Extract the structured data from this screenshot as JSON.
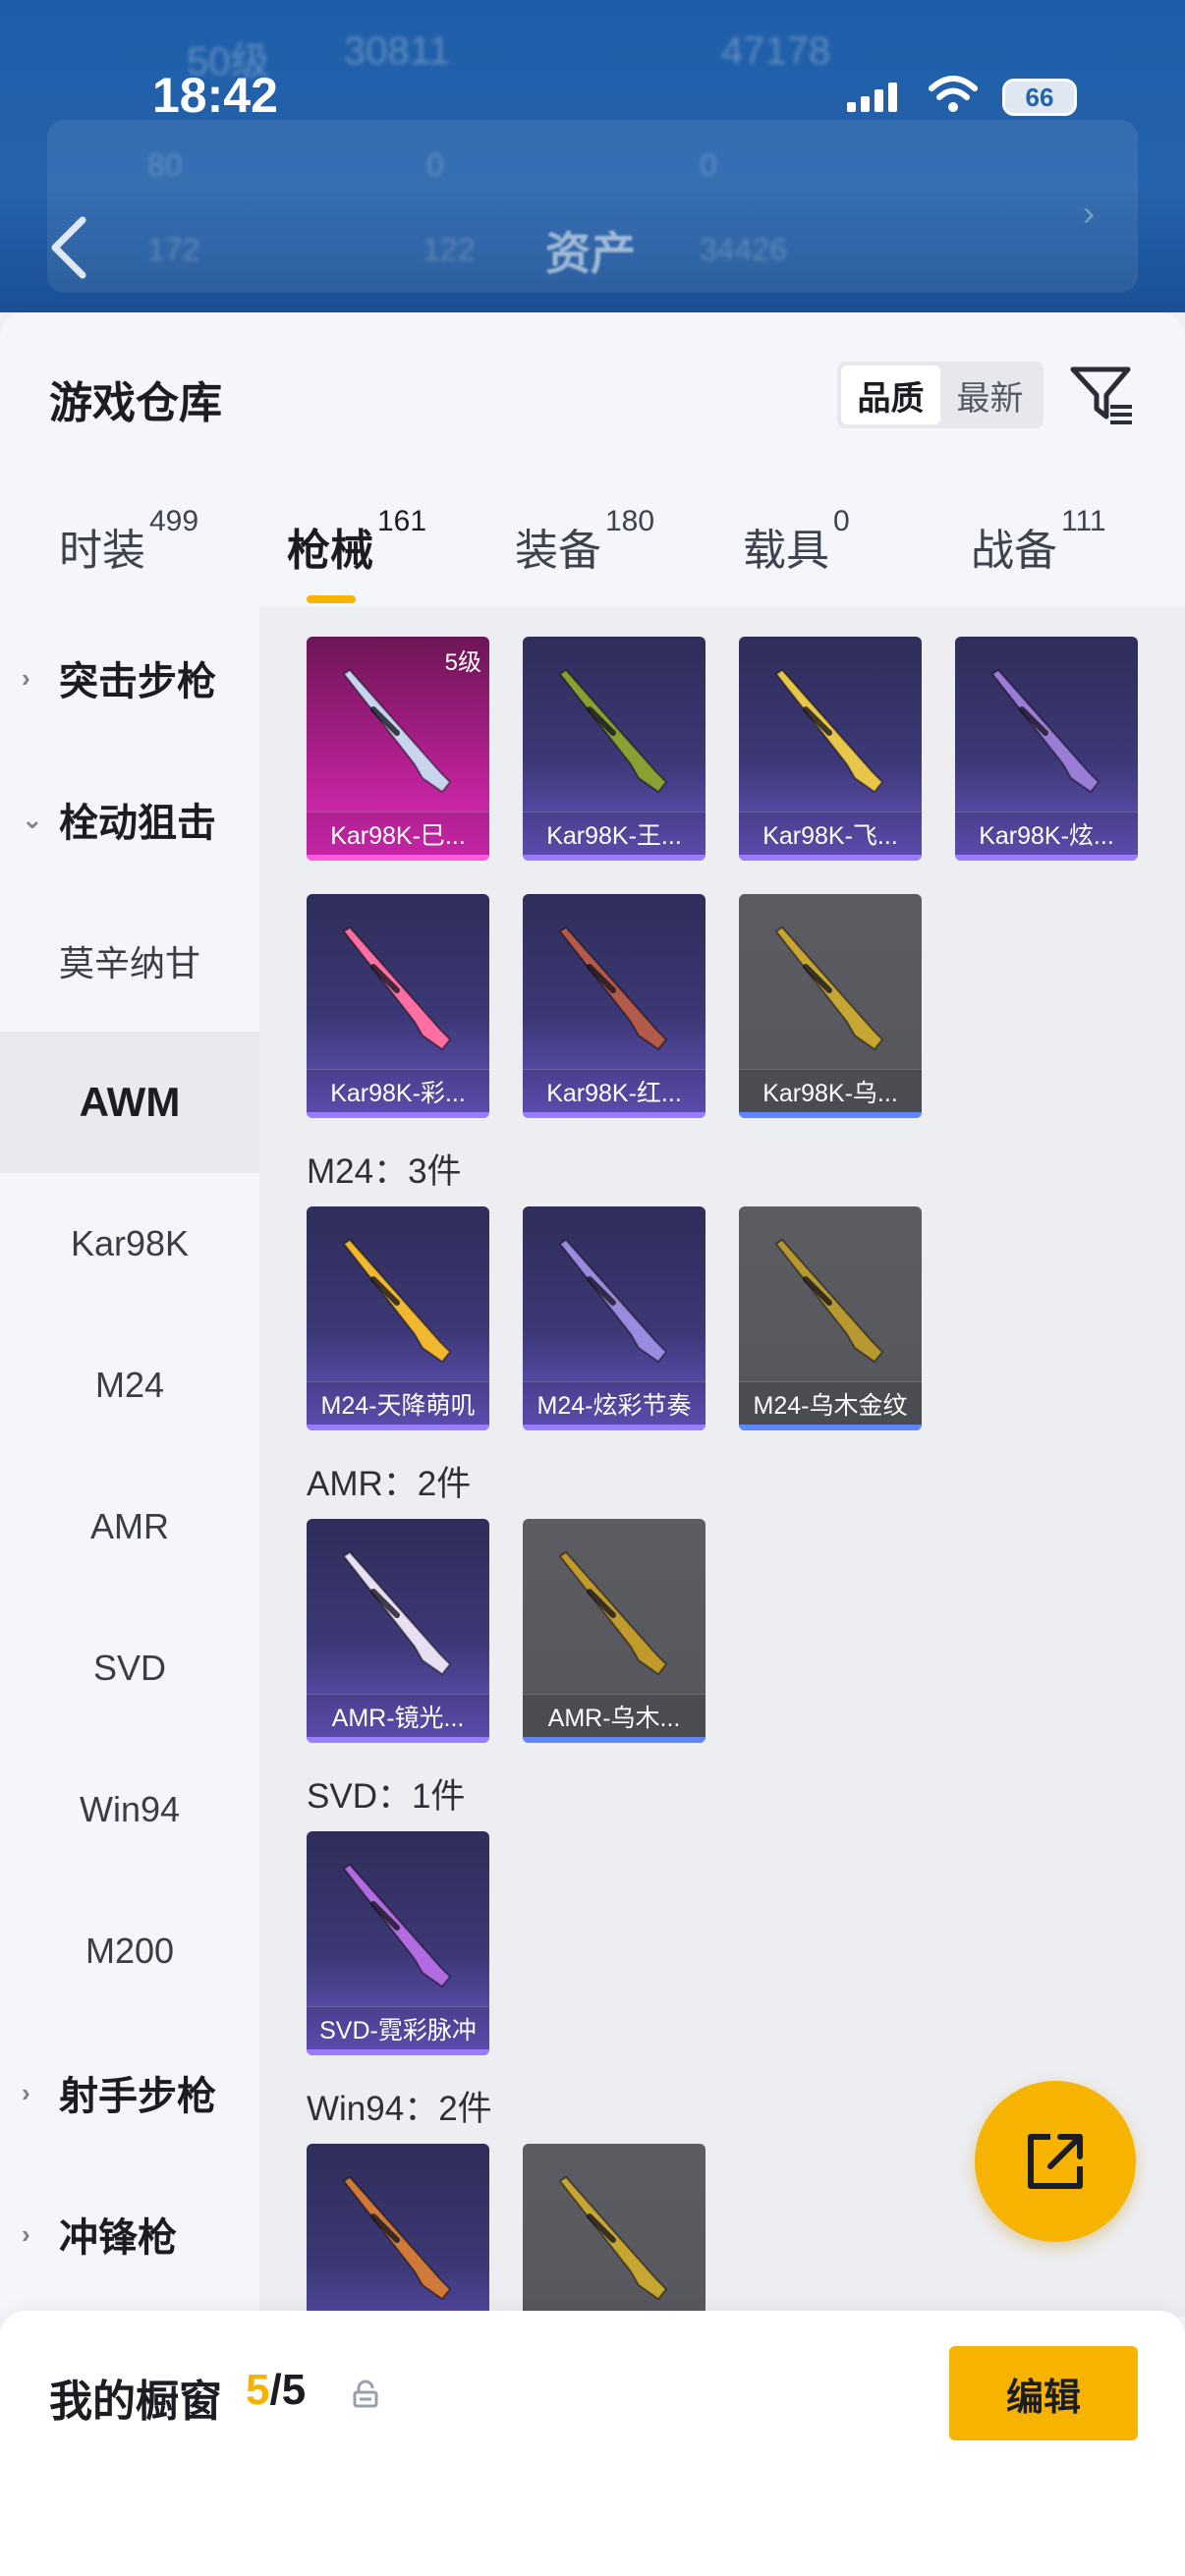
{
  "status_bar": {
    "time": "18:42",
    "battery": "66"
  },
  "background_header": {
    "level": "50级",
    "coins": "30811",
    "score": "47178",
    "stat1": "80",
    "stat2": "0",
    "stat3": "0",
    "stat4": "172",
    "stat5": "122",
    "stat6": "34426",
    "title": "资产"
  },
  "warehouse": {
    "title": "游戏仓库",
    "sort_options": [
      {
        "label": "品质",
        "active": true
      },
      {
        "label": "最新",
        "active": false
      }
    ],
    "tabs": [
      {
        "label": "时装",
        "count": "499",
        "active": false
      },
      {
        "label": "枪械",
        "count": "161",
        "active": true
      },
      {
        "label": "装备",
        "count": "180",
        "active": false
      },
      {
        "label": "载具",
        "count": "0",
        "active": false
      },
      {
        "label": "战备",
        "count": "111",
        "active": false
      }
    ],
    "categories": [
      {
        "label": "突击步枪",
        "type": "group",
        "expanded": false
      },
      {
        "label": "栓动狙击",
        "type": "group",
        "expanded": true
      },
      {
        "label": "莫辛纳甘",
        "type": "item"
      },
      {
        "label": "AWM",
        "type": "item",
        "selected": true
      },
      {
        "label": "Kar98K",
        "type": "item"
      },
      {
        "label": "M24",
        "type": "item"
      },
      {
        "label": "AMR",
        "type": "item"
      },
      {
        "label": "SVD",
        "type": "item"
      },
      {
        "label": "Win94",
        "type": "item"
      },
      {
        "label": "M200",
        "type": "item"
      },
      {
        "label": "射手步枪",
        "type": "group",
        "expanded": false
      },
      {
        "label": "冲锋枪",
        "type": "group",
        "expanded": false
      }
    ],
    "sections": {
      "m24": "M24：3件",
      "amr": "AMR：2件",
      "svd": "SVD：1件",
      "win94": "Win94：2件"
    },
    "kar98k_items": [
      {
        "name": "Kar98K-巳...",
        "rarity": "pink",
        "level": "5级",
        "gun_color": "#c9d4ef"
      },
      {
        "name": "Kar98K-王...",
        "rarity": "purple",
        "gun_color": "#8aa033"
      },
      {
        "name": "Kar98K-飞...",
        "rarity": "purple",
        "gun_color": "#e8c64a"
      },
      {
        "name": "Kar98K-炫...",
        "rarity": "purple",
        "gun_color": "#9b7dd8"
      },
      {
        "name": "Kar98K-彩...",
        "rarity": "purple",
        "gun_color": "#ff6fa3"
      },
      {
        "name": "Kar98K-红...",
        "rarity": "purple",
        "gun_color": "#b45a4a"
      },
      {
        "name": "Kar98K-乌...",
        "rarity": "gray",
        "gun_color": "#c8a634"
      }
    ],
    "m24_items": [
      {
        "name": "M24-天降萌叽",
        "rarity": "purple",
        "gun_color": "#f0b72f"
      },
      {
        "name": "M24-炫彩节奏",
        "rarity": "purple",
        "gun_color": "#9a8be0"
      },
      {
        "name": "M24-乌木金纹",
        "rarity": "gray",
        "gun_color": "#b89830"
      }
    ],
    "amr_items": [
      {
        "name": "AMR-镜光...",
        "rarity": "purple",
        "gun_color": "#e8e0f2"
      },
      {
        "name": "AMR-乌木...",
        "rarity": "gray",
        "gun_color": "#c19a2c"
      }
    ],
    "svd_items": [
      {
        "name": "SVD-霓彩脉冲",
        "rarity": "purple",
        "gun_color": "#b26be0"
      }
    ],
    "win94_items": [
      {
        "name": "",
        "rarity": "purple",
        "gun_color": "#d07a3a"
      },
      {
        "name": "",
        "rarity": "gray",
        "gun_color": "#c8a634"
      }
    ]
  },
  "showcase": {
    "label": "我的橱窗",
    "current": "5",
    "total": "/5",
    "edit_label": "编辑"
  },
  "colors": {
    "accent": "#f6b400",
    "purple_rarity": "#6a58c9",
    "pink_rarity": "#e22bbf",
    "gray_rarity": "#55575d"
  }
}
